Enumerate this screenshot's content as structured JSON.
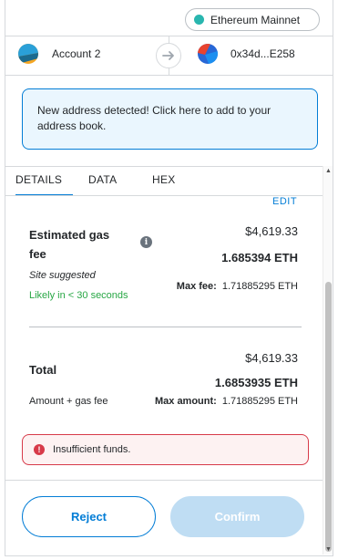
{
  "network": {
    "name": "Ethereum Mainnet",
    "dot_color": "#29b6af"
  },
  "accounts": {
    "from_name": "Account 2",
    "to_address": "0x34d...E258"
  },
  "notice": {
    "text": "New address detected! Click here to add to your address book."
  },
  "tabs": [
    {
      "label": "DETAILS",
      "active": true
    },
    {
      "label": "DATA",
      "active": false
    },
    {
      "label": "HEX",
      "active": false
    }
  ],
  "edit_label": "EDIT",
  "gas": {
    "title": "Estimated gas fee",
    "fiat": "$4,619.33",
    "eth": "1.685394 ETH",
    "site_suggested": "Site suggested",
    "likely": "Likely in < 30 seconds",
    "max_fee_label": "Max fee:",
    "max_fee_value": "1.71885295 ETH"
  },
  "total": {
    "label": "Total",
    "fiat": "$4,619.33",
    "eth": "1.6853935 ETH",
    "sub_label": "Amount + gas fee",
    "max_amount_label": "Max amount:",
    "max_amount_value": "1.71885295 ETH"
  },
  "error": {
    "text": "Insufficient funds."
  },
  "buttons": {
    "reject": "Reject",
    "confirm": "Confirm"
  },
  "colors": {
    "primary": "#037dd6",
    "success": "#28a745",
    "error": "#d73a49",
    "confirm_disabled": "#bfddf3"
  }
}
